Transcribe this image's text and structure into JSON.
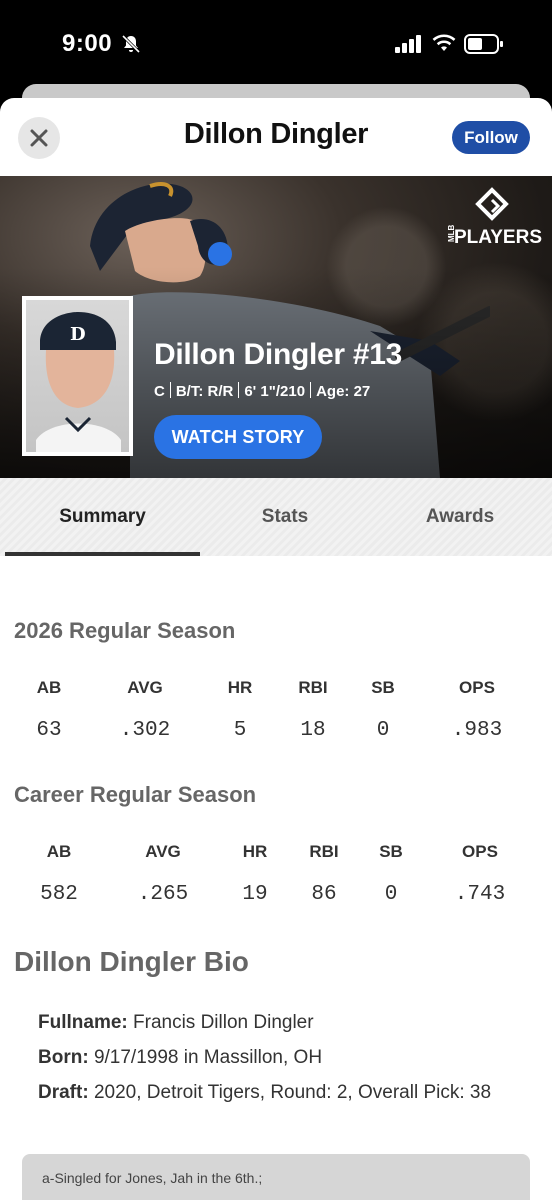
{
  "status_bar": {
    "time": "9:00",
    "icons": [
      "bell-slash-icon",
      "signal-icon",
      "wifi-icon",
      "battery-icon"
    ]
  },
  "header": {
    "close_icon": "close-icon",
    "title": "Dillon Dingler",
    "follow_label": "Follow"
  },
  "hero": {
    "logo": {
      "mark": "MLB",
      "text": "PLAYERS"
    },
    "player_name": "Dillon Dingler #13",
    "position": "C",
    "bats_throws": "B/T: R/R",
    "height_weight": "6' 1\"/210",
    "age": "Age: 27",
    "watch_story_label": "WATCH STORY"
  },
  "tabs": [
    {
      "label": "Summary",
      "active": true
    },
    {
      "label": "Stats",
      "active": false
    },
    {
      "label": "Awards",
      "active": false
    }
  ],
  "season_stats": {
    "title": "2026 Regular Season",
    "headers": [
      "AB",
      "AVG",
      "HR",
      "RBI",
      "SB",
      "OPS"
    ],
    "values": [
      "63",
      ".302",
      "5",
      "18",
      "0",
      ".983"
    ]
  },
  "career_stats": {
    "title": "Career Regular Season",
    "headers": [
      "AB",
      "AVG",
      "HR",
      "RBI",
      "SB",
      "OPS"
    ],
    "values": [
      "582",
      ".265",
      "19",
      "86",
      "0",
      ".743"
    ]
  },
  "bio": {
    "title": "Dillon Dingler Bio",
    "fullname_label": "Fullname:",
    "fullname": "Francis Dillon Dingler",
    "born_label": "Born:",
    "born": "9/17/1998 in Massillon, OH",
    "draft_label": "Draft:",
    "draft": "2020, Detroit Tigers, Round: 2, Overall Pick: 38"
  },
  "toast": {
    "text": "a-Singled for Jones, Jah in the 6th.;"
  },
  "colors": {
    "follow_bg": "#1f4ea6",
    "watch_story_bg": "#2a73e4"
  }
}
